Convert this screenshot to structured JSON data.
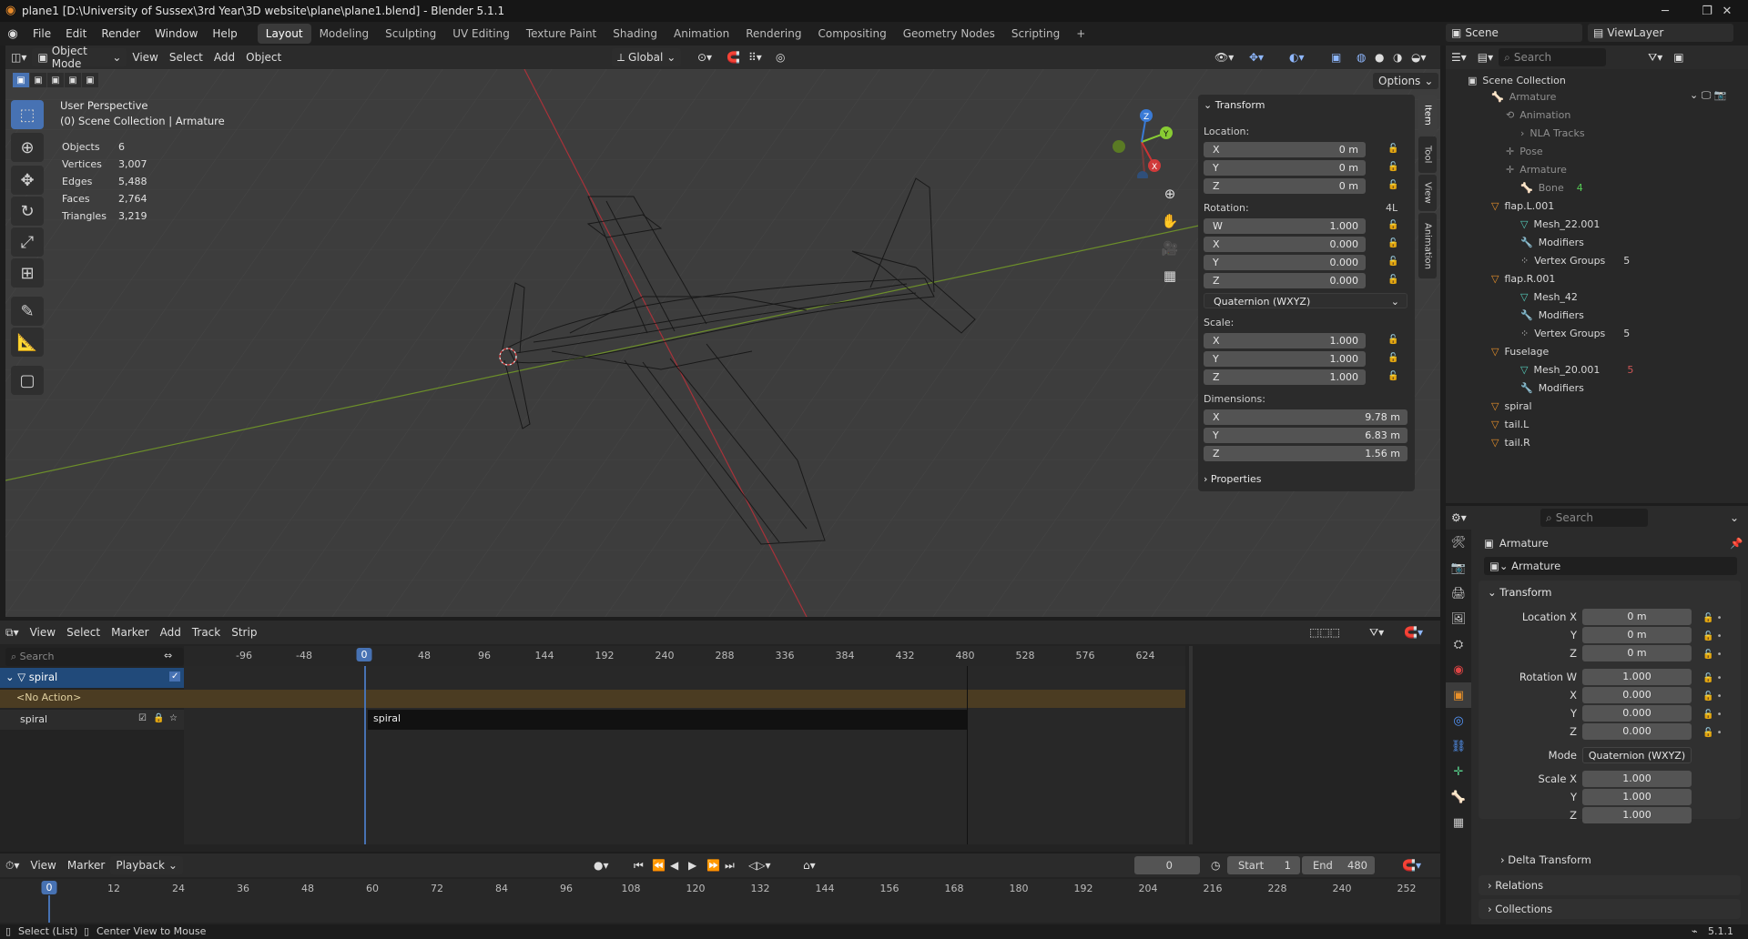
{
  "window": {
    "title": "plane1 [D:\\University of Sussex\\3rd Year\\3D website\\plane\\plane1.blend] - Blender 5.1.1",
    "min": "─",
    "max": "❐",
    "close": "✕"
  },
  "menu": [
    "File",
    "Edit",
    "Render",
    "Window",
    "Help"
  ],
  "workspaces": [
    "Layout",
    "Modeling",
    "Sculpting",
    "UV Editing",
    "Texture Paint",
    "Shading",
    "Animation",
    "Rendering",
    "Compositing",
    "Geometry Nodes",
    "Scripting"
  ],
  "workspace_add": "+",
  "scene": {
    "name": "Scene",
    "viewlayer": "ViewLayer"
  },
  "viewport_header": {
    "mode": "Object Mode",
    "menus": [
      "View",
      "Select",
      "Add",
      "Object"
    ],
    "orientation": "Global",
    "options": "Options"
  },
  "viewport": {
    "persp": "User Perspective",
    "collection": "(0) Scene Collection | Armature",
    "stats": [
      {
        "k": "Objects",
        "v": "6"
      },
      {
        "k": "Vertices",
        "v": "3,007"
      },
      {
        "k": "Edges",
        "v": "5,488"
      },
      {
        "k": "Faces",
        "v": "2,764"
      },
      {
        "k": "Triangles",
        "v": "3,219"
      }
    ]
  },
  "npanel": {
    "header": "Transform",
    "location_label": "Location:",
    "location": [
      {
        "a": "X",
        "v": "0 m"
      },
      {
        "a": "Y",
        "v": "0 m"
      },
      {
        "a": "Z",
        "v": "0 m"
      }
    ],
    "rotation_label": "Rotation:",
    "rotation_mode_short": "4L",
    "rotation": [
      {
        "a": "W",
        "v": "1.000"
      },
      {
        "a": "X",
        "v": "0.000"
      },
      {
        "a": "Y",
        "v": "0.000"
      },
      {
        "a": "Z",
        "v": "0.000"
      }
    ],
    "rotation_mode": "Quaternion (WXYZ)",
    "scale_label": "Scale:",
    "scale": [
      {
        "a": "X",
        "v": "1.000"
      },
      {
        "a": "Y",
        "v": "1.000"
      },
      {
        "a": "Z",
        "v": "1.000"
      }
    ],
    "dimensions_label": "Dimensions:",
    "dimensions": [
      {
        "a": "X",
        "v": "9.78 m"
      },
      {
        "a": "Y",
        "v": "6.83 m"
      },
      {
        "a": "Z",
        "v": "1.56 m"
      }
    ],
    "properties": "Properties",
    "tabs": [
      "Item",
      "Tool",
      "View",
      "Animation"
    ]
  },
  "gizmo": {
    "x": "X",
    "y": "Y",
    "z": "Z"
  },
  "outliner": {
    "search": "Search",
    "root": "Scene Collection",
    "rows": [
      "Armature",
      "Animation",
      "NLA Tracks",
      "Pose",
      "Armature",
      "Bone",
      "flap.L.001",
      "Mesh_22.001",
      "Modifiers",
      "Vertex Groups",
      "flap.R.001",
      "Mesh_42",
      "Modifiers",
      "Vertex Groups",
      "Fuselage",
      "Mesh_20.001",
      "Modifiers",
      "spiral",
      "tail.L",
      "tail.R"
    ],
    "badges": {
      "bone": "4",
      "vg1": "5",
      "vg2": "5",
      "mesh20": "5"
    }
  },
  "properties": {
    "search": "Search",
    "object": "Armature",
    "datablock": "Armature",
    "section": "Transform",
    "rows": [
      {
        "k": "Location X",
        "v": "0 m"
      },
      {
        "k": "Y",
        "v": "0 m"
      },
      {
        "k": "Z",
        "v": "0 m"
      },
      {
        "k": "Rotation W",
        "v": "1.000"
      },
      {
        "k": "X",
        "v": "0.000"
      },
      {
        "k": "Y",
        "v": "0.000"
      },
      {
        "k": "Z",
        "v": "0.000"
      },
      {
        "k": "Mode",
        "v": "Quaternion (WXYZ)"
      },
      {
        "k": "Scale X",
        "v": "1.000"
      },
      {
        "k": "Y",
        "v": "1.000"
      },
      {
        "k": "Z",
        "v": "1.000"
      }
    ],
    "subsections": [
      "Delta Transform",
      "Relations",
      "Collections"
    ]
  },
  "nla": {
    "menus": [
      "View",
      "Select",
      "Marker",
      "Add",
      "Track",
      "Strip"
    ],
    "search": "Search",
    "ticks": [
      "-96",
      "-48",
      "0",
      "48",
      "96",
      "144",
      "192",
      "240",
      "288",
      "336",
      "384",
      "432",
      "480",
      "528",
      "576",
      "624"
    ],
    "object": "spiral",
    "no_action": "<No Action>",
    "track": "spiral",
    "strip": "spiral"
  },
  "timeline": {
    "menus": [
      "View",
      "Marker"
    ],
    "playback": "Playback",
    "current": "0",
    "start_label": "Start",
    "start": "1",
    "end_label": "End",
    "end": "480",
    "ticks": [
      "0",
      "12",
      "24",
      "36",
      "48",
      "60",
      "72",
      "84",
      "96",
      "108",
      "120",
      "132",
      "144",
      "156",
      "168",
      "180",
      "192",
      "204",
      "216",
      "228",
      "240",
      "252"
    ]
  },
  "status": {
    "left1": "Select (List)",
    "left2": "Center View to Mouse",
    "version": "5.1.1"
  }
}
